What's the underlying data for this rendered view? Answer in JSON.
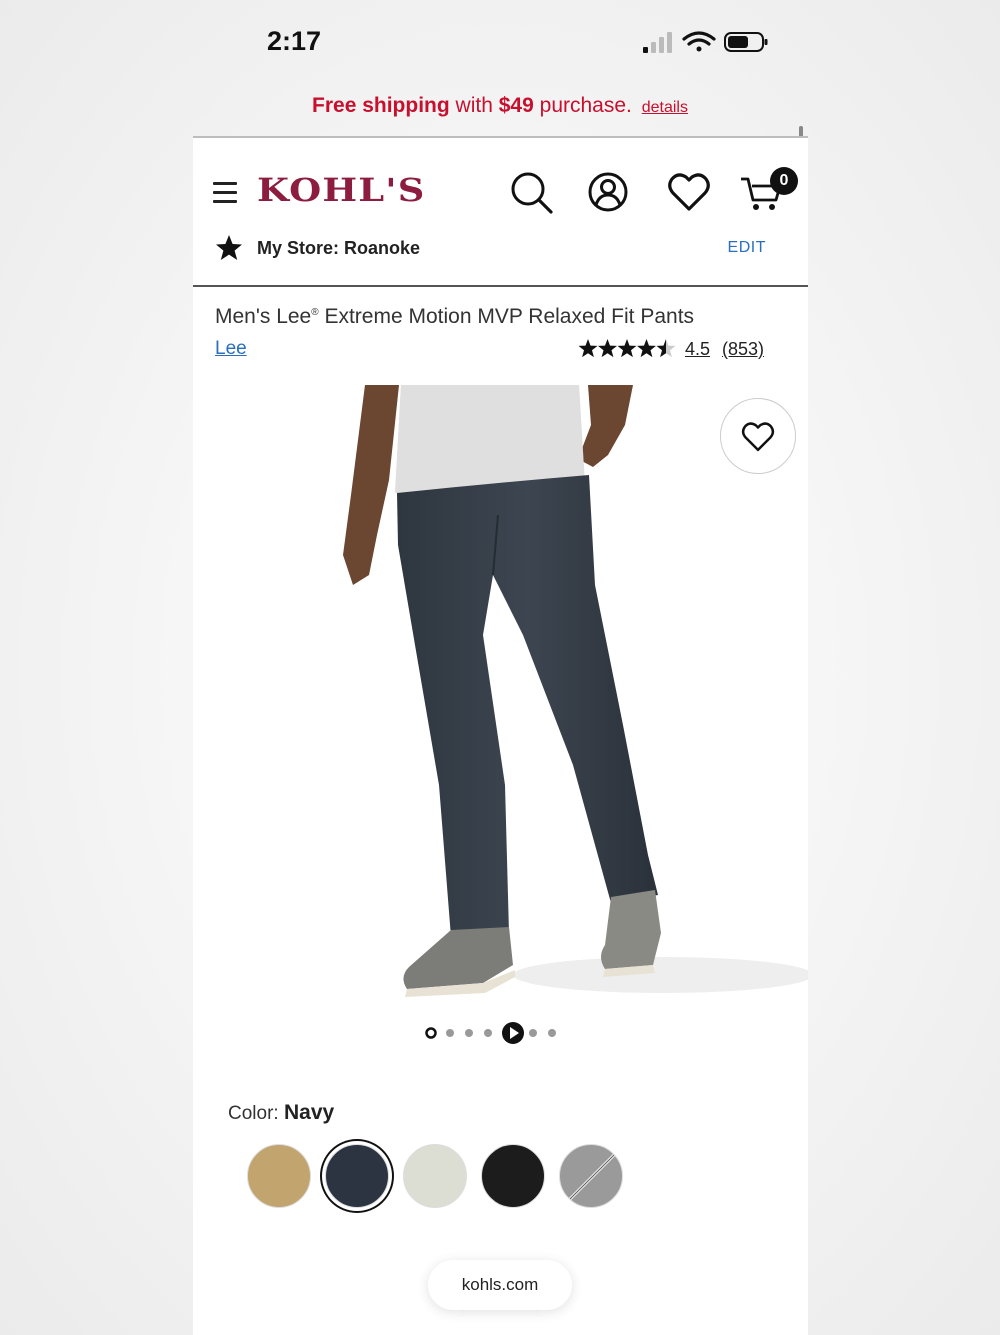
{
  "status_bar": {
    "time": "2:17"
  },
  "promo": {
    "free_shipping": "Free shipping",
    "with": "with",
    "amount": "$49",
    "purchase": "purchase.",
    "details": "details"
  },
  "header": {
    "logo": "KOHL'S",
    "cart_count": "0"
  },
  "store": {
    "label": "My Store: Roanoke",
    "edit": "EDIT"
  },
  "product": {
    "title": "Men's Lee",
    "title_mark": "®",
    "title_rest": " Extreme Motion MVP Relaxed Fit Pants",
    "brand": "Lee",
    "rating": "4.5",
    "rating_value": 4.5,
    "review_count": "(853)"
  },
  "carousel": {
    "total": 7,
    "active_index": 4
  },
  "color": {
    "label": "Color:",
    "selected": "Navy",
    "swatches": [
      "#c2a46e",
      "#2b3440",
      "#dcddd3",
      "#1c1c1c",
      "#9a9a9a"
    ],
    "selected_index": 1
  },
  "browser": {
    "url": "kohls.com"
  }
}
